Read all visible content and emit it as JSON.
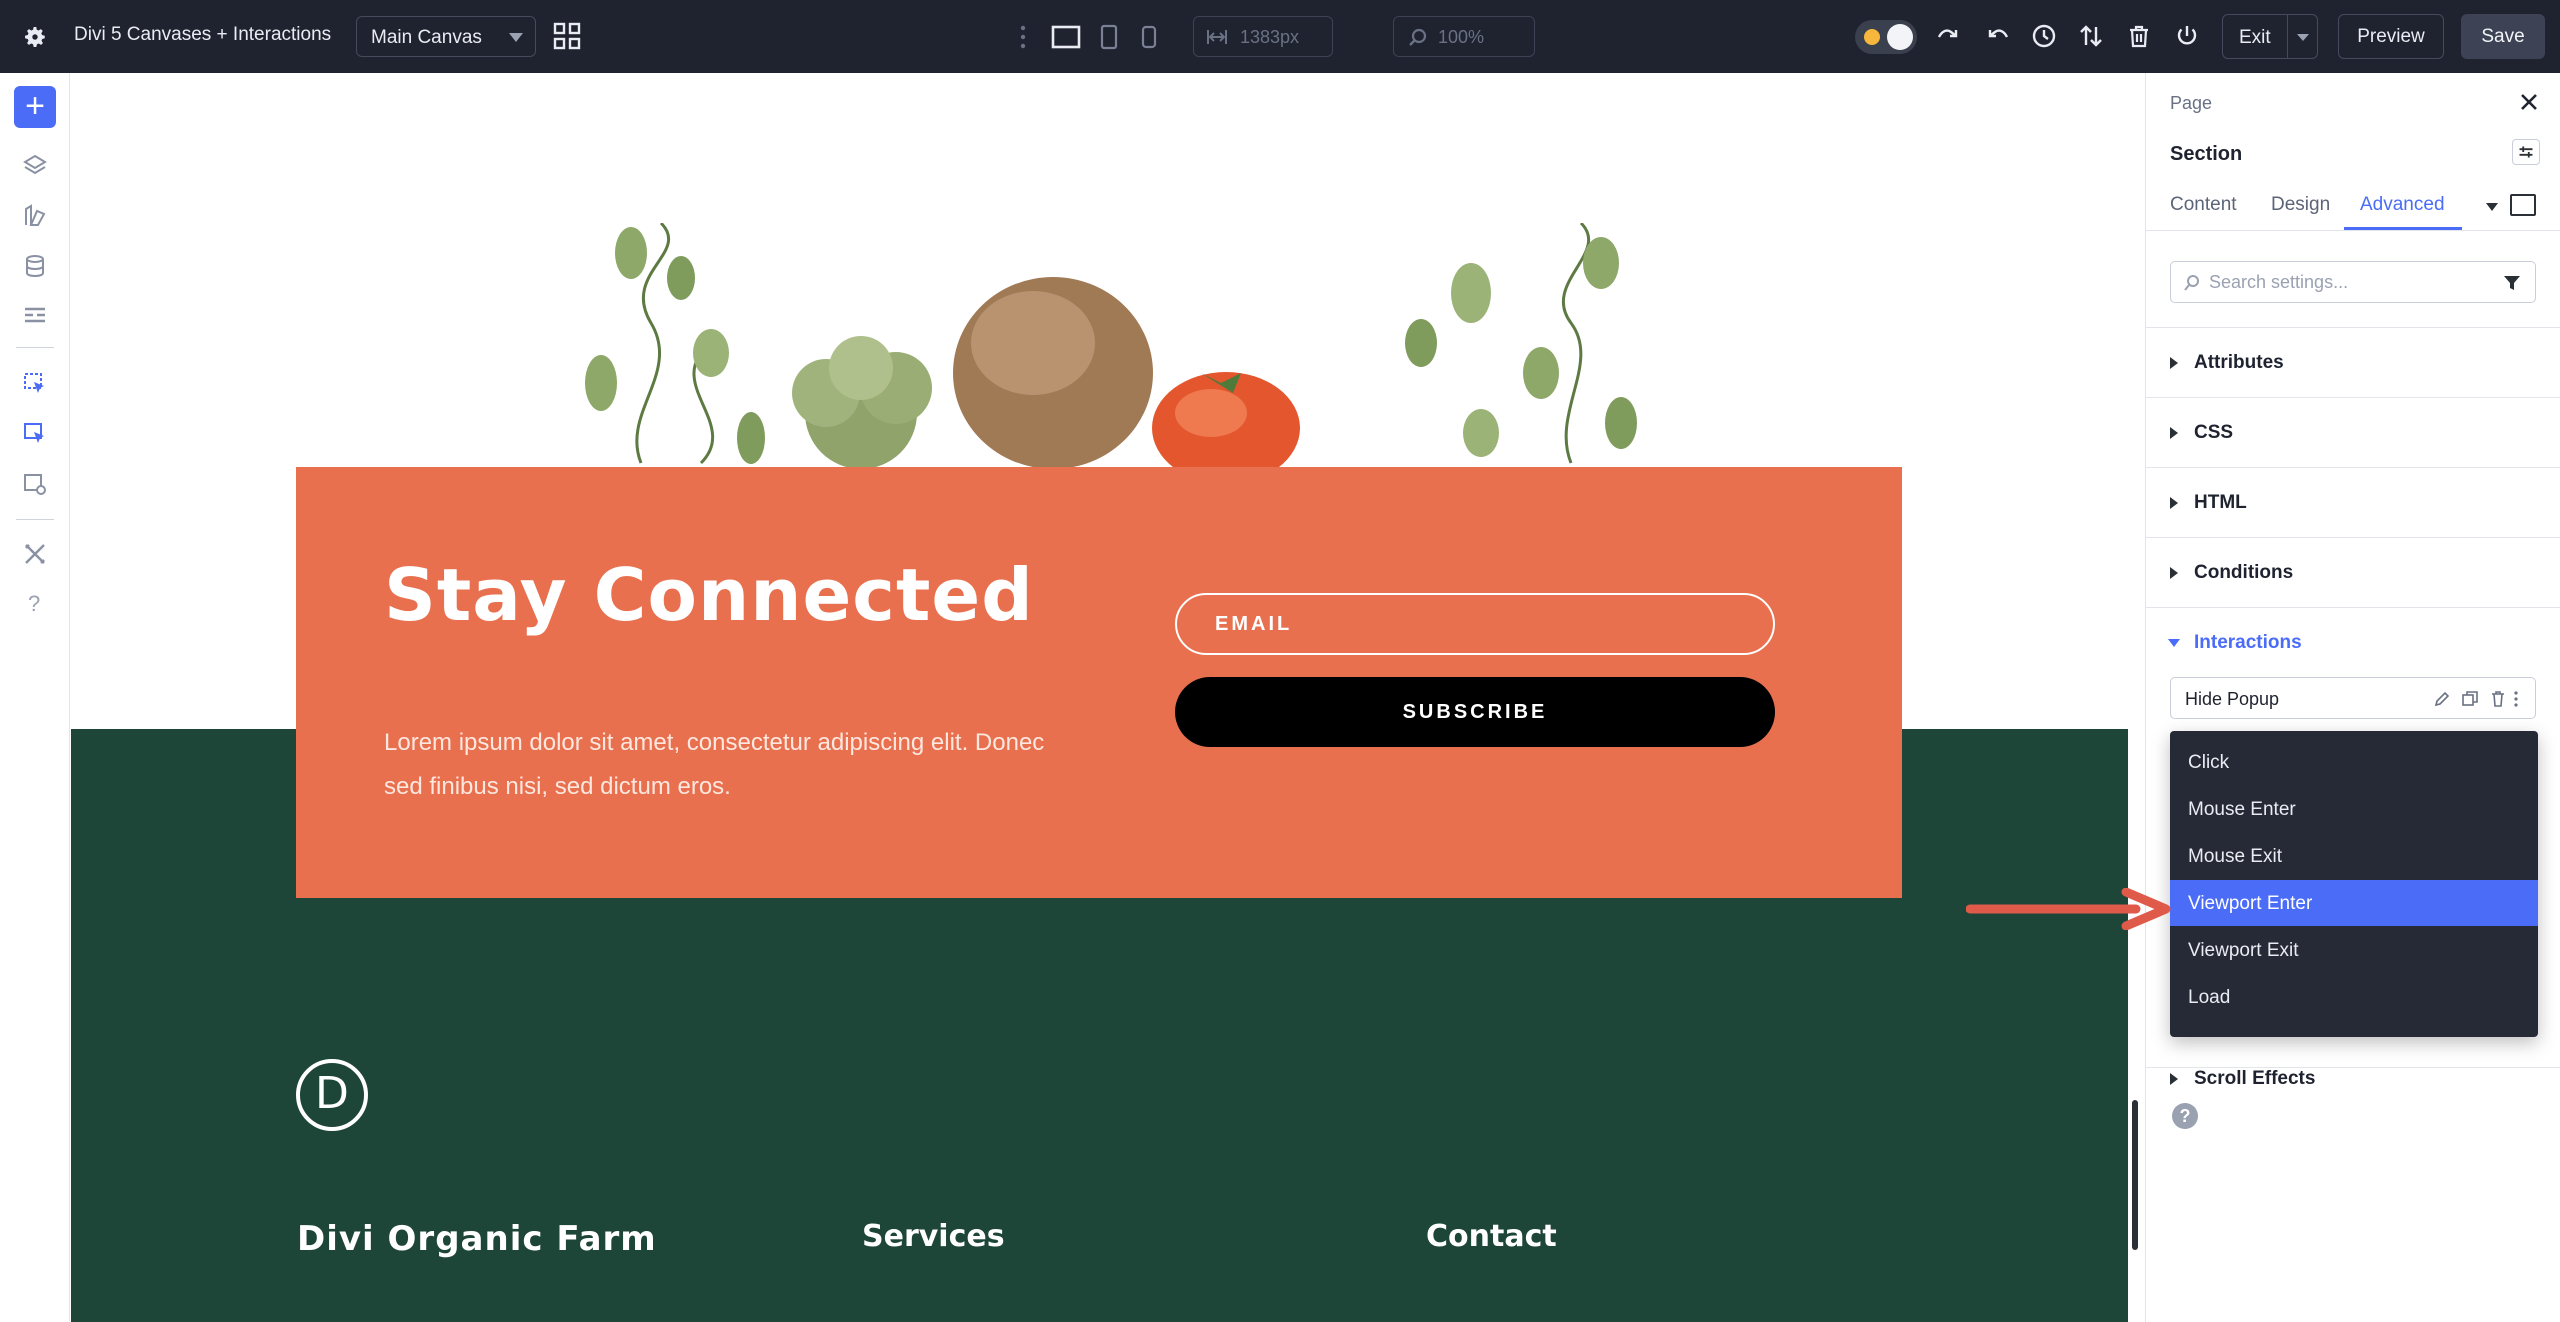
{
  "topbar": {
    "app_title": "Divi 5 Canvases + Interactions",
    "canvas_select": "Main Canvas",
    "width_value": "1383px",
    "zoom_value": "100%",
    "exit_label": "Exit",
    "preview_label": "Preview",
    "save_label": "Save"
  },
  "canvas": {
    "heading": "Stay Connected",
    "paragraph": "Lorem ipsum dolor sit amet, consectetur adipiscing elit. Donec sed finibus nisi, sed dictum eros.",
    "email_placeholder": "EMAIL",
    "subscribe_label": "SUBSCRIBE",
    "logo_letter": "D",
    "footer": {
      "col1": "Divi Organic Farm",
      "col2": "Services",
      "col3": "Contact"
    }
  },
  "panel": {
    "breadcrumb": "Page",
    "section_title": "Section",
    "tabs": [
      "Content",
      "Design",
      "Advanced"
    ],
    "active_tab": "Advanced",
    "search_placeholder": "Search settings...",
    "accordions": [
      "Attributes",
      "CSS",
      "HTML",
      "Conditions",
      "Interactions"
    ],
    "open_accordion": "Interactions",
    "interaction_item": "Hide Popup",
    "trigger_options": [
      "Click",
      "Mouse Enter",
      "Mouse Exit",
      "Viewport Enter",
      "Viewport Exit",
      "Load"
    ],
    "selected_trigger": "Viewport Enter",
    "below_dropdown": "Scroll Effects",
    "help": "?"
  },
  "colors": {
    "accent": "#4a6cf7",
    "topbar": "#1f2330",
    "orange": "#e8704e",
    "green": "#1e4638",
    "arrow": "#e05a4a"
  }
}
